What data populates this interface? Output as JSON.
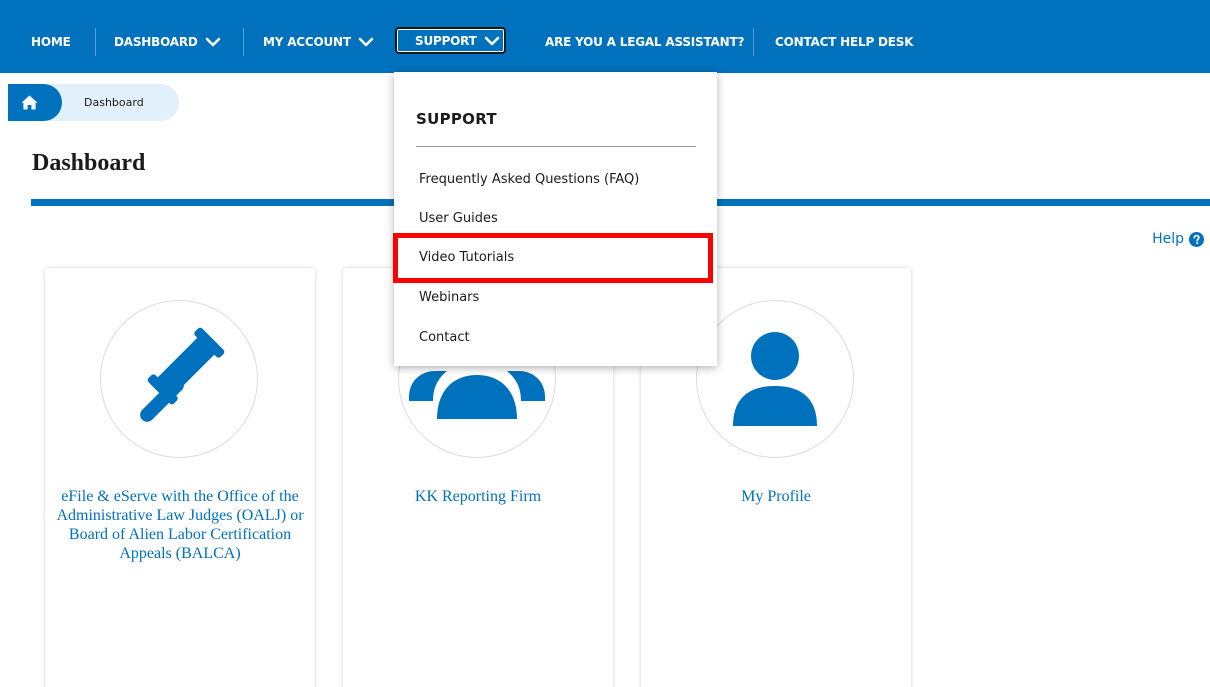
{
  "nav": {
    "home": "HOME",
    "dashboard": "DASHBOARD",
    "my_account": "MY ACCOUNT",
    "support": "SUPPORT",
    "legal_assistant": "ARE YOU A LEGAL ASSISTANT?",
    "contact_help_desk": "CONTACT HELP DESK",
    "chevron_icon": "chevron-down-icon"
  },
  "breadcrumb": {
    "home_icon": "home-icon",
    "current": "Dashboard"
  },
  "page": {
    "title": "Dashboard",
    "help_label": "Help",
    "help_icon": "question-circle-icon"
  },
  "support_menu": {
    "heading": "SUPPORT",
    "items": [
      "Frequently Asked Questions (FAQ)",
      "User Guides",
      "Video Tutorials",
      "Webinars",
      "Contact"
    ],
    "highlighted_item": "Video Tutorials"
  },
  "cards": [
    {
      "icon": "gavel-icon",
      "label": "eFile & eServe with the Office of the Administrative Law Judges (OALJ) or Board of Alien Labor Certification Appeals (BALCA)"
    },
    {
      "icon": "group-icon",
      "label": "KK Reporting Firm"
    },
    {
      "icon": "user-icon",
      "label": "My Profile"
    }
  ],
  "colors": {
    "brand_blue": "#0071bc",
    "highlight_red": "#ff0000",
    "breadcrumb_bg": "#e1f0fa"
  }
}
